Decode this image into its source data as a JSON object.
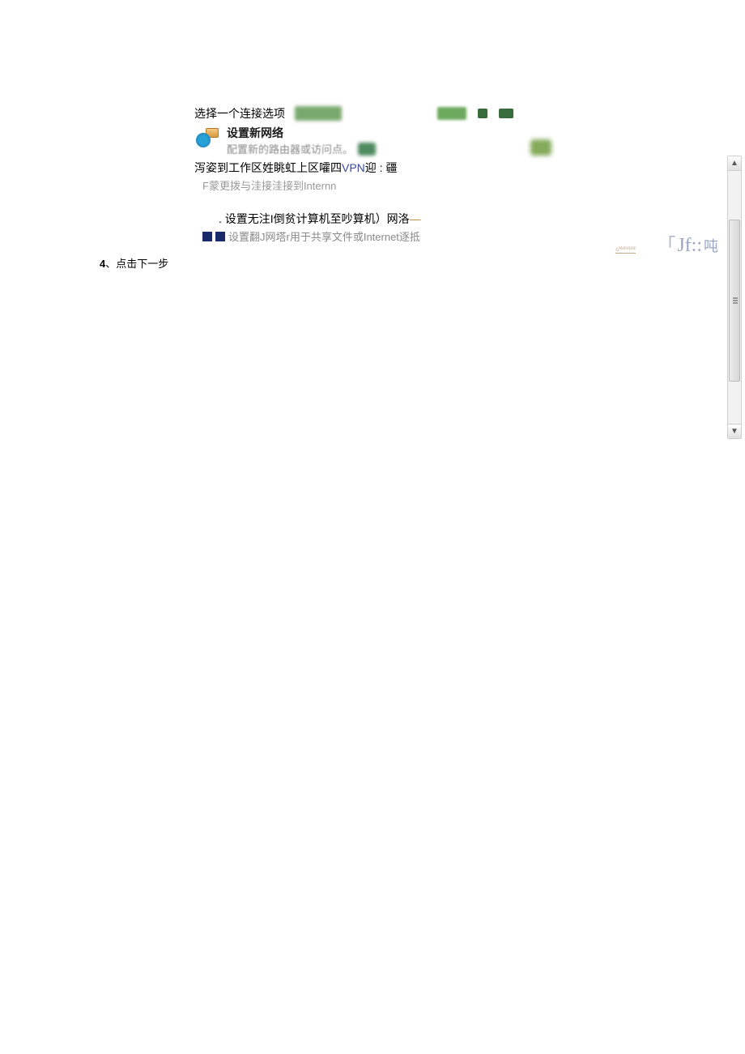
{
  "dialog": {
    "title": "选择一个连接选项",
    "option1": {
      "title": "设置新网络",
      "subtitle": "配置新的路由器或访问点。"
    },
    "line3_prefix": "泻姿到工作区",
    "line3_mid": "姓眺虹上区嚯四",
    "line3_vpn": "VPN",
    "line3_suffix": "迎 : 疆",
    "line4": "F蒙更拨与洼接洼接到Internn",
    "line5_prefix": ". 设置无注I倒贫计算机至吵算机）网洛",
    "line6": "设置翻J网塔r用于共享文件或Internet逐抵"
  },
  "step": {
    "num": "4",
    "sep": "、",
    "text": "点击下一步"
  },
  "right": {
    "bracket": "「",
    "jf": "Jf::",
    "suffix": "吨",
    "deco": "ɢᴺᴹᴱᵂᴮᴺᴱ"
  }
}
